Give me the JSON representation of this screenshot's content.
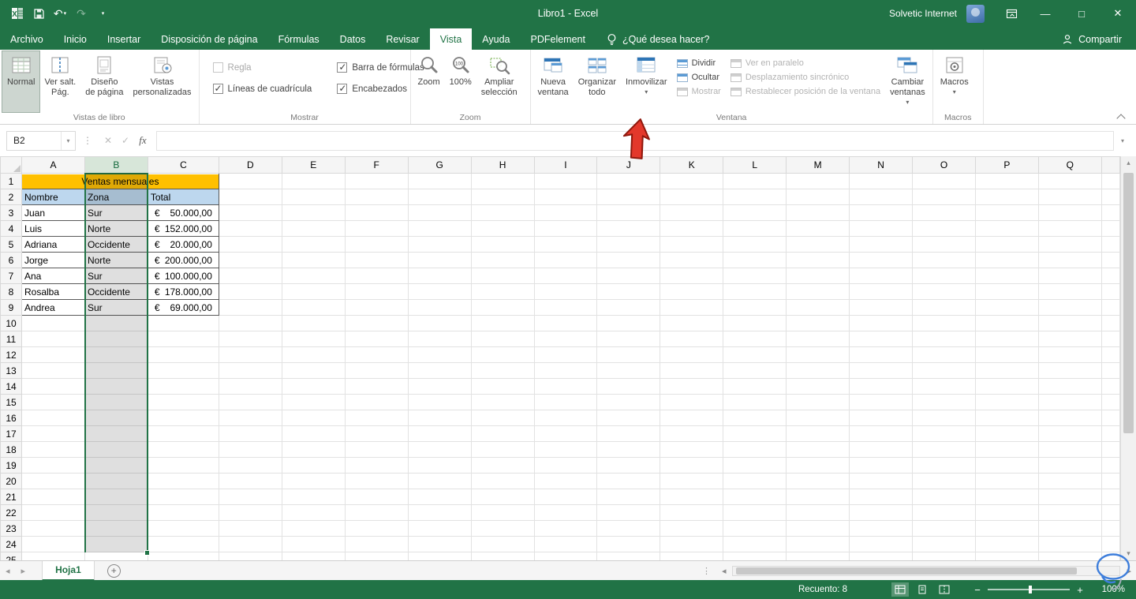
{
  "titlebar": {
    "title": "Libro1  -  Excel",
    "user": "Solvetic Internet"
  },
  "glyphs": {
    "dropdown": "▾",
    "undo": "↶",
    "redo": "↷",
    "minimize": "—",
    "maximize": "□",
    "close": "✕",
    "check": "✓",
    "cross": "✕",
    "dots": "⋮",
    "tri_left": "◂",
    "tri_right": "▸",
    "tri_up": "▴",
    "tri_down": "▾",
    "plus": "+",
    "minus": "−"
  },
  "tabs": {
    "archivo": "Archivo",
    "inicio": "Inicio",
    "insertar": "Insertar",
    "disposicion": "Disposición de página",
    "formulas": "Fórmulas",
    "datos": "Datos",
    "revisar": "Revisar",
    "vista": "Vista",
    "ayuda": "Ayuda",
    "pdfelement": "PDFelement",
    "tellme": "¿Qué desea hacer?",
    "compartir": "Compartir"
  },
  "ribbon": {
    "vistas_group": {
      "label": "Vistas de libro",
      "normal": "Normal",
      "salt": "Ver salt.\nPág.",
      "diseno": "Diseño\nde página",
      "personalizadas": "Vistas\npersonalizadas"
    },
    "mostrar_group": {
      "label": "Mostrar",
      "regla": "Regla",
      "lineas": "Líneas de cuadrícula",
      "barra": "Barra de fórmulas",
      "encabezados": "Encabezados"
    },
    "zoom_group": {
      "label": "Zoom",
      "zoom": "Zoom",
      "cien": "100%",
      "ampliar": "Ampliar\nselección"
    },
    "ventana_group": {
      "label": "Ventana",
      "nueva": "Nueva\nventana",
      "organizar": "Organizar\ntodo",
      "inmovilizar": "Inmovilizar",
      "dividir": "Dividir",
      "ocultar": "Ocultar",
      "mostrar": "Mostrar",
      "paralelo": "Ver en paralelo",
      "sincronico": "Desplazamiento sincrónico",
      "restablecer": "Restablecer posición de la ventana",
      "cambiar": "Cambiar\nventanas"
    },
    "macros_group": {
      "label": "Macros",
      "macros": "Macros"
    }
  },
  "formula_bar": {
    "name_box": "B2",
    "fx_label": "fx"
  },
  "sheet": {
    "columns": [
      "A",
      "B",
      "C",
      "D",
      "E",
      "F",
      "G",
      "H",
      "I",
      "J",
      "K",
      "L",
      "M",
      "N",
      "O",
      "P",
      "Q"
    ],
    "col_widths": {
      "gutter": 27,
      "default": 80,
      "A": 80,
      "B": 80,
      "C": 90,
      "partial": 23
    },
    "row_count": 24,
    "selected_column": "B",
    "title": "Ventas mensuales",
    "headers": [
      "Nombre",
      "Zona",
      "Total"
    ],
    "currency": "€",
    "records": [
      [
        "Juan",
        "Sur",
        "50.000,00"
      ],
      [
        "Luis",
        "Norte",
        "152.000,00"
      ],
      [
        "Adriana",
        "Occidente",
        "20.000,00"
      ],
      [
        "Jorge",
        "Norte",
        "200.000,00"
      ],
      [
        "Ana",
        "Sur",
        "100.000,00"
      ],
      [
        "Rosalba",
        "Occidente",
        "178.000,00"
      ],
      [
        "Andrea",
        "Sur",
        "69.000,00"
      ]
    ]
  },
  "sheet_tabs": {
    "hoja1": "Hoja1"
  },
  "status_bar": {
    "count": "Recuento: 8",
    "zoom": "100%"
  },
  "colors": {
    "excel_green": "#217346",
    "banner_yellow": "#FFC000",
    "header_blue": "#BDD7EE",
    "arrow_red": "#E3382B"
  }
}
